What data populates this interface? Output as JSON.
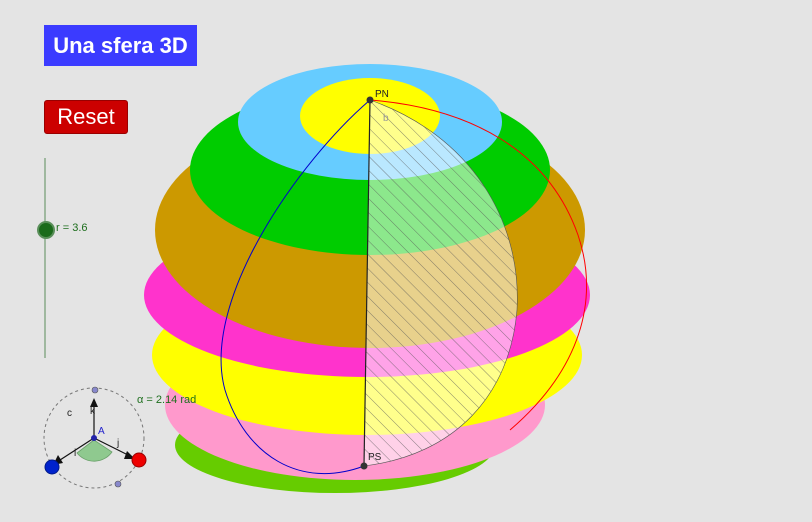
{
  "title": "Una sfera 3D",
  "reset_label": "Reset",
  "slider": {
    "label": "r = 3.6",
    "value": 3.6
  },
  "angle_label": "α = 2.14 rad",
  "points": {
    "north": "PN",
    "south": "PS",
    "b_label": "b"
  },
  "axes": {
    "origin": "A",
    "i": "i",
    "j": "j",
    "k": "k",
    "c": "c"
  },
  "colors": {
    "title_bg": "#3b3bff",
    "reset_bg": "#cc0000",
    "band_yellow": "#ffff00",
    "band_light_blue": "#66ccff",
    "band_green": "#00cc00",
    "band_ochre": "#cc9900",
    "band_magenta": "#ff33cc",
    "band_pink": "#ff99cc",
    "meridian_blue": "#0000cc",
    "meridian_red": "#ff0000"
  }
}
